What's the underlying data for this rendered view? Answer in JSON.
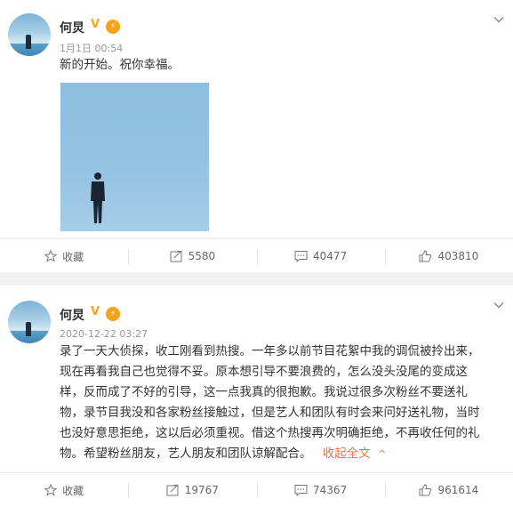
{
  "posts": [
    {
      "author": "何炅",
      "vip": "V",
      "time": "1月1日 00:54",
      "content": "新的开始。祝你幸福。",
      "actions": {
        "favorite": "收藏",
        "repost": "5580",
        "comment": "40477",
        "like": "403810"
      }
    },
    {
      "author": "何炅",
      "vip": "V",
      "time": "2020-12-22 03:27",
      "lines": [
        "录了一天大侦探，收工刚看到热搜。一年多以前节目花絮中我的调侃被拎出来，",
        "现在再看我自己也觉得不妥。原本想引导不要浪费的，怎么没头没尾的变成这",
        "样，反而成了不好的引导，这一点我真的很抱歉。我说过很多次粉丝不要送礼",
        "物，录节目我没和各家粉丝接触过，但是艺人和团队有时会来问好送礼物，当时",
        "也没好意思拒绝，这以后必须重视。借这个热搜再次明确拒绝，不再收任何的礼",
        "物。希望粉丝朋友，艺人朋友和团队谅解配合。"
      ],
      "collapse": "收起全文",
      "collapse_arrow": "^",
      "actions": {
        "favorite": "收藏",
        "repost": "19767",
        "comment": "74367",
        "like": "961614"
      }
    }
  ],
  "colors": {
    "accent": "#eb7350",
    "vip": "#f5a623"
  }
}
